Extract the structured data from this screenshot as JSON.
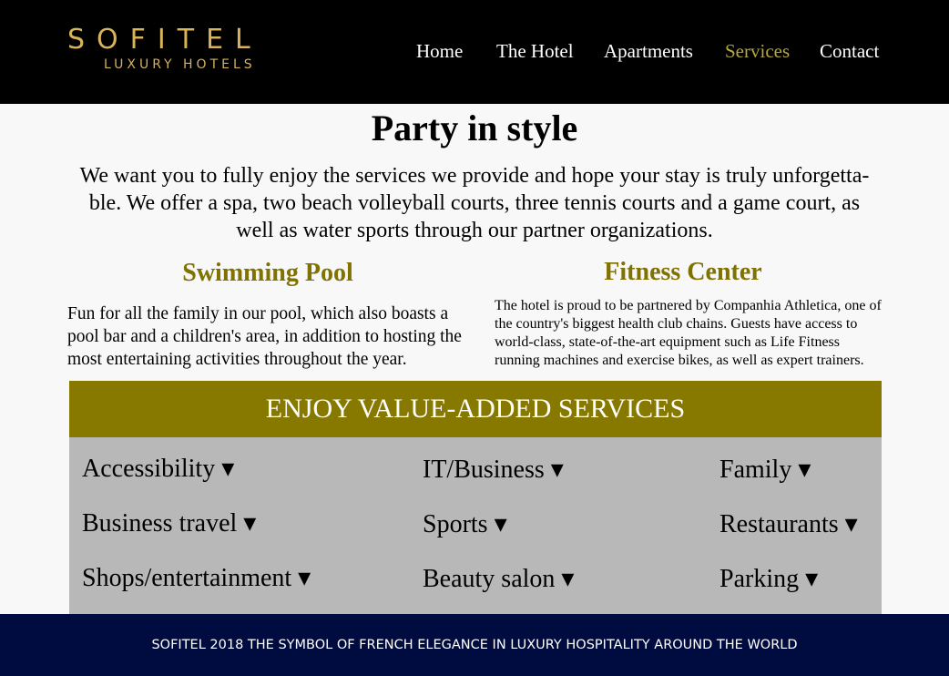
{
  "brand": {
    "name": "SOFITEL",
    "tagline": "LUXURY HOTELS",
    "gold_color": "#d7b35a"
  },
  "nav": {
    "items": [
      {
        "label": "Home"
      },
      {
        "label": "The Hotel"
      },
      {
        "label": "Apartments"
      },
      {
        "label": "Services",
        "active": true
      },
      {
        "label": "Contact"
      }
    ],
    "active_color": "#b6a93a"
  },
  "main": {
    "title": "Party in style",
    "intro": "We want you to fully enjoy the services we provide and hope your stay is truly unforgetta-ble. We offer a spa, two beach volleyball courts, three tennis courts and a game court, as well as water sports through our partner organizations.",
    "pool": {
      "heading": "Swimming Pool",
      "text": "Fun for all the family in our pool, which also boasts a pool bar and a children's area, in addition to hosting the most entertaining activities throughout the year."
    },
    "fitness": {
      "heading": "Fitness Center",
      "text": "The hotel is proud to be partnered by Companhia Athletica, one of the country's biggest health club chains. Guests have access to world-class, state-of-the-art equipment such as Life Fitness running machines and exercise bikes, as well as expert trainers."
    },
    "heading_color": "#7f7200"
  },
  "services": {
    "heading": "ENJOY VALUE-ADDED SERVICES",
    "heading_bg": "#877900",
    "items": [
      "Accessibility ▾",
      "IT/Business ▾",
      "Family ▾",
      "Business travel ▾",
      "Sports ▾",
      "Restaurants ▾",
      "Shops/entertainment ▾",
      "Beauty salon ▾",
      "Parking ▾"
    ]
  },
  "footer": {
    "text": "SOFITEL 2018 THE SYMBOL OF FRENCH ELEGANCE IN LUXURY HOSPITALITY AROUND THE WORLD",
    "bg": "#000b40"
  }
}
